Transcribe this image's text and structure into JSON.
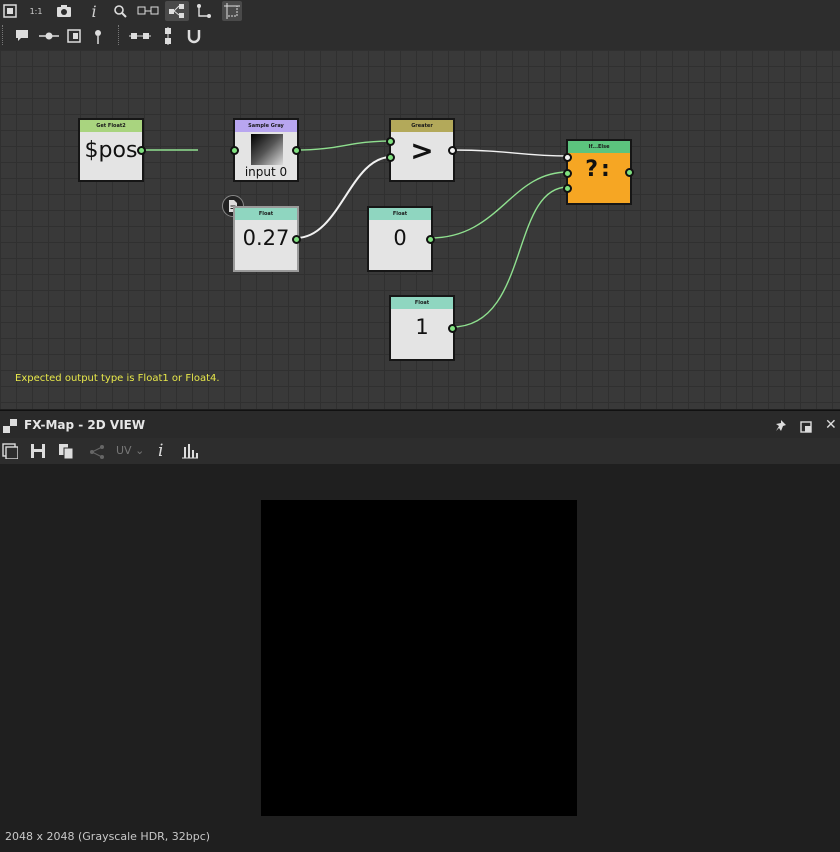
{
  "graph": {
    "nodes": {
      "get_float2": {
        "title": "Get Float2",
        "value": "$pos",
        "color": "#a9d47f"
      },
      "sample_gray": {
        "title": "Sample Gray",
        "value": "input 0",
        "color": "#b8a6f0"
      },
      "greater": {
        "title": "Greater",
        "value": ">",
        "color": "#b3a95a"
      },
      "if_else": {
        "title": "If...Else",
        "value": "?:",
        "color": "#5cc47e",
        "body_color": "#f6a623"
      },
      "float_027": {
        "title": "Float",
        "value": "0.27",
        "color": "#8fd6c0"
      },
      "float_0": {
        "title": "Float",
        "value": "0",
        "color": "#8fd6c0"
      },
      "float_1": {
        "title": "Float",
        "value": "1",
        "color": "#8fd6c0"
      }
    },
    "warning": "Expected output type is Float1 or Float4."
  },
  "view": {
    "title": "FX-Map - 2D VIEW",
    "uv_label": "UV",
    "status": "2048 x 2048 (Grayscale HDR, 32bpc)"
  },
  "colors": {
    "wire": "#8fe08f",
    "port": "#7fe07f",
    "warning": "#e8e84a",
    "accent_orange": "#f6a623"
  },
  "icons": [
    "fit-view-icon",
    "zoom-1-1-icon",
    "camera-icon",
    "info-icon",
    "search-icon",
    "frame-nodes-icon",
    "layout-tree-icon",
    "connector-icon",
    "grid-snap-icon",
    "comment-icon",
    "pin-node-icon",
    "frame-icon",
    "dot-node-icon",
    "align-horizontal-icon",
    "align-vertical-icon",
    "magnet-icon"
  ]
}
